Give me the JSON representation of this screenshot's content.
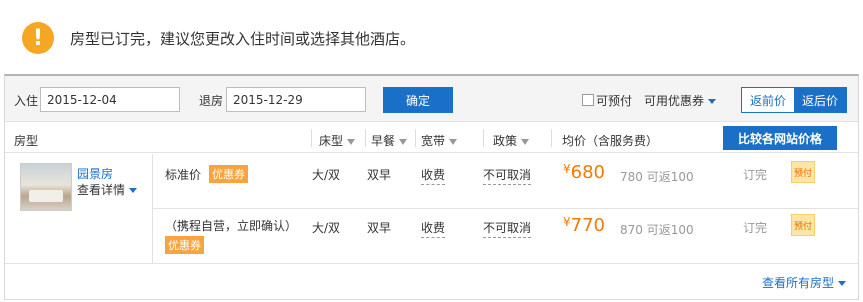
{
  "notice": {
    "icon": "exclamation-icon",
    "symbol": "!",
    "text": "房型已订完，建议您更改入住时间或选择其他酒店。"
  },
  "filter": {
    "checkin_label": "入住",
    "checkin_value": "2015-12-04",
    "checkout_label": "退房",
    "checkout_value": "2015-12-29",
    "confirm_label": "确定",
    "prepay_label": "可预付",
    "coupon_label": "可用优惠券",
    "return_before_label": "返前价",
    "return_after_label": "返后价"
  },
  "columns": {
    "room_type": "房型",
    "bed": "床型",
    "breakfast": "早餐",
    "broadband": "宽带",
    "policy": "政策",
    "price": "均价（含服务费）",
    "compare_label": "比较各网站价格"
  },
  "room": {
    "name": "园景房",
    "detail": "查看详情",
    "rates": [
      {
        "name": "标准价",
        "coupon": "优惠券",
        "bed": "大/双",
        "breakfast": "双早",
        "broadband": "收费",
        "policy": "不可取消",
        "currency": "¥",
        "price": "680",
        "rebate": "780 可返100",
        "status": "订完",
        "prepay": "预付"
      },
      {
        "name": "（携程自营，立即确认）",
        "coupon": "优惠券",
        "bed": "大/双",
        "breakfast": "双早",
        "broadband": "收费",
        "policy": "不可取消",
        "currency": "¥",
        "price": "770",
        "rebate": "870 可返100",
        "status": "订完",
        "prepay": "预付"
      }
    ]
  },
  "footer": {
    "view_all": "查看所有房型"
  },
  "colors": {
    "accent": "#1a6fc6",
    "price": "#f37a00",
    "coupon": "#f7a33e",
    "warning": "#f5a623"
  }
}
